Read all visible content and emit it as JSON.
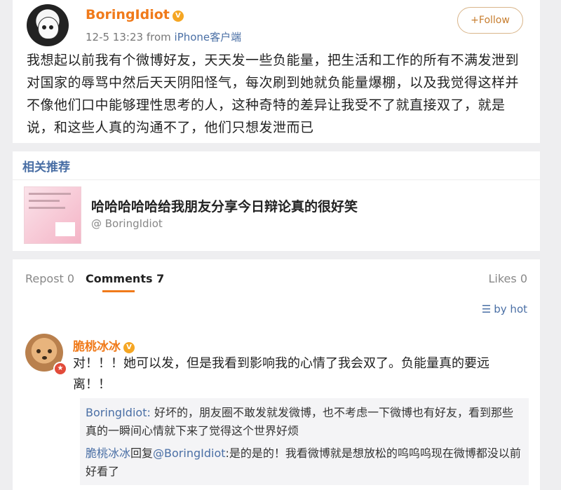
{
  "post": {
    "username": "BoringIdiot",
    "timestamp": "12-5 13:23",
    "source_prefix": "from",
    "source": "iPhone客户端",
    "follow_label": "+Follow",
    "text": "我想起以前我有个微博好友，天天发一些负能量，把生活和工作的所有不满发泄到对国家的辱骂中然后天天阴阳怪气，每次刷到她就负能量爆棚，以及我觉得这样并不像他们口中能够理性思考的人，这种奇特的差异让我受不了就直接双了，就是说，和这些人真的沟通不了，他们只想发泄而已"
  },
  "related": {
    "title": "相关推荐",
    "headline": "哈哈哈哈哈给我朋友分享今日辩论真的很好笑",
    "author": "@ BoringIdiot"
  },
  "tabs": {
    "repost": "Repost 0",
    "comments": "Comments 7",
    "likes": "Likes 0"
  },
  "sort_label": "by hot",
  "comment": {
    "name": "脆桃冰冰",
    "text": "对！！！她可以发，但是我看到影响我的心情了我会双了。负能量真的要远离！！",
    "replies": [
      {
        "who": "BoringIdiot:",
        "text": " 好坏的，朋友圈不敢发就发微博，也不考虑一下微博也有好友，看到那些真的一瞬间心情就下来了觉得这个世界好烦"
      },
      {
        "who": "脆桃冰冰",
        "mid": "回复",
        "mention": "@BoringIdiot",
        "text": ":是的是的！我看微博就是想放松的呜呜呜现在微博都没以前好看了"
      }
    ]
  },
  "colors": {
    "accent_orange": "#f07a1a",
    "link_blue": "#4a6fa5",
    "background": "#eeeef0"
  }
}
